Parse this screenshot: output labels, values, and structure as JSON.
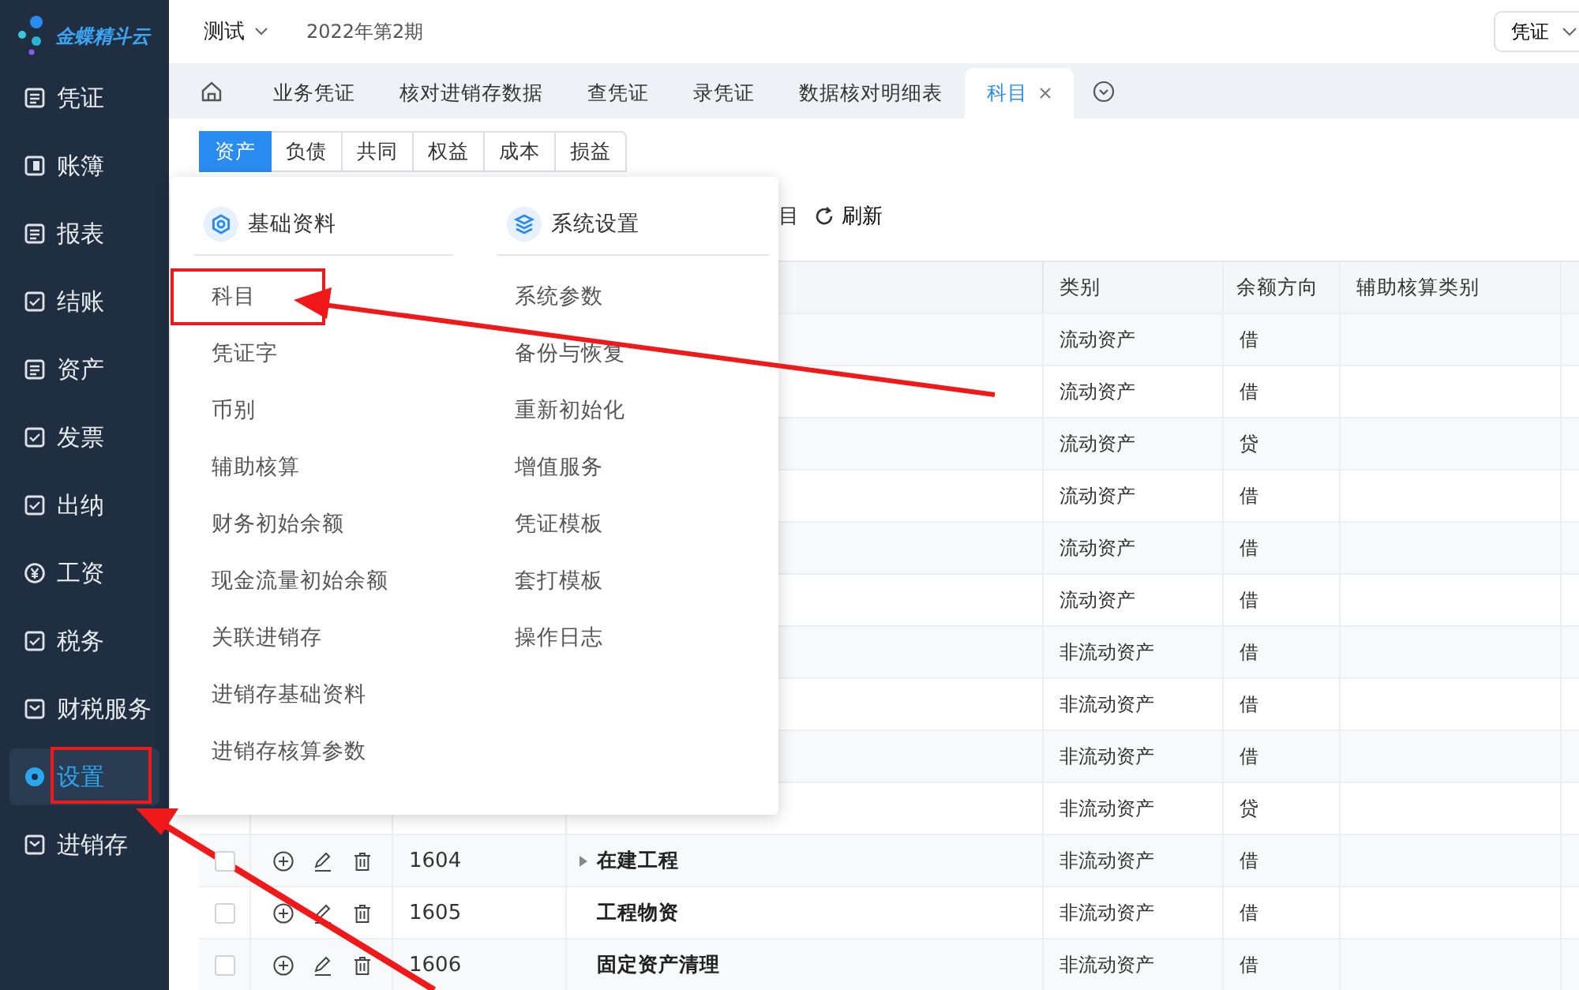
{
  "sidebar": {
    "logo": "金蝶精斗云",
    "items": [
      {
        "label": "凭证",
        "selected": false
      },
      {
        "label": "账簿",
        "selected": false
      },
      {
        "label": "报表",
        "selected": false
      },
      {
        "label": "结账",
        "selected": false
      },
      {
        "label": "资产",
        "selected": false
      },
      {
        "label": "发票",
        "selected": false
      },
      {
        "label": "出纳",
        "selected": false
      },
      {
        "label": "工资",
        "selected": false
      },
      {
        "label": "税务",
        "selected": false
      },
      {
        "label": "财税服务",
        "selected": false
      },
      {
        "label": "设置",
        "selected": true
      },
      {
        "label": "进销存",
        "selected": false
      }
    ]
  },
  "header": {
    "account": "测试",
    "period": "2022年第2期",
    "quick_menu": "凭证"
  },
  "tabs": [
    {
      "label": "业务凭证",
      "selected": false,
      "closable": false
    },
    {
      "label": "核对进销存数据",
      "selected": false,
      "closable": false
    },
    {
      "label": "查凭证",
      "selected": false,
      "closable": false
    },
    {
      "label": "录凭证",
      "selected": false,
      "closable": false
    },
    {
      "label": "数据核对明细表",
      "selected": false,
      "closable": false
    },
    {
      "label": "科目",
      "selected": true,
      "closable": true
    }
  ],
  "subtabs": [
    {
      "label": "资产",
      "selected": true
    },
    {
      "label": "负债",
      "selected": false
    },
    {
      "label": "共同",
      "selected": false
    },
    {
      "label": "权益",
      "selected": false
    },
    {
      "label": "成本",
      "selected": false
    },
    {
      "label": "损益",
      "selected": false
    }
  ],
  "toolbar": {
    "partial_label": "目",
    "refresh": "刷新"
  },
  "table": {
    "columns": [
      "类别",
      "余额方向",
      "辅助核算类别"
    ],
    "rows": [
      {
        "category": "流动资产",
        "direction": "借"
      },
      {
        "category": "流动资产",
        "direction": "借"
      },
      {
        "category": "流动资产",
        "direction": "贷"
      },
      {
        "category": "流动资产",
        "direction": "借"
      },
      {
        "category": "流动资产",
        "direction": "借"
      },
      {
        "category": "流动资产",
        "direction": "借"
      },
      {
        "category": "非流动资产",
        "direction": "借"
      },
      {
        "category": "非流动资产",
        "direction": "借"
      },
      {
        "category": "非流动资产",
        "direction": "借"
      },
      {
        "category": "非流动资产",
        "direction": "贷"
      },
      {
        "code": "1604",
        "name": "在建工程",
        "expandable": true,
        "checked": false,
        "category": "非流动资产",
        "direction": "借"
      },
      {
        "code": "1605",
        "name": "工程物资",
        "expandable": false,
        "checked": false,
        "category": "非流动资产",
        "direction": "借"
      },
      {
        "code": "1606",
        "name": "固定资产清理",
        "expandable": false,
        "checked": false,
        "category": "非流动资产",
        "direction": "借"
      }
    ]
  },
  "settings_menu": {
    "columns": [
      {
        "title": "基础资料",
        "items": [
          {
            "label": "科目",
            "highlighted": true
          },
          {
            "label": "凭证字",
            "highlighted": false
          },
          {
            "label": "币别",
            "highlighted": false
          },
          {
            "label": "辅助核算",
            "highlighted": false
          },
          {
            "label": "财务初始余额",
            "highlighted": false
          },
          {
            "label": "现金流量初始余额",
            "highlighted": false
          },
          {
            "label": "关联进销存",
            "highlighted": false
          },
          {
            "label": "进销存基础资料",
            "highlighted": false
          },
          {
            "label": "进销存核算参数",
            "highlighted": false
          }
        ]
      },
      {
        "title": "系统设置",
        "items": [
          {
            "label": "系统参数",
            "highlighted": false
          },
          {
            "label": "备份与恢复",
            "highlighted": false
          },
          {
            "label": "重新初始化",
            "highlighted": false
          },
          {
            "label": "增值服务",
            "highlighted": false
          },
          {
            "label": "凭证模板",
            "highlighted": false
          },
          {
            "label": "套打模板",
            "highlighted": false
          },
          {
            "label": "操作日志",
            "highlighted": false
          }
        ]
      }
    ]
  }
}
